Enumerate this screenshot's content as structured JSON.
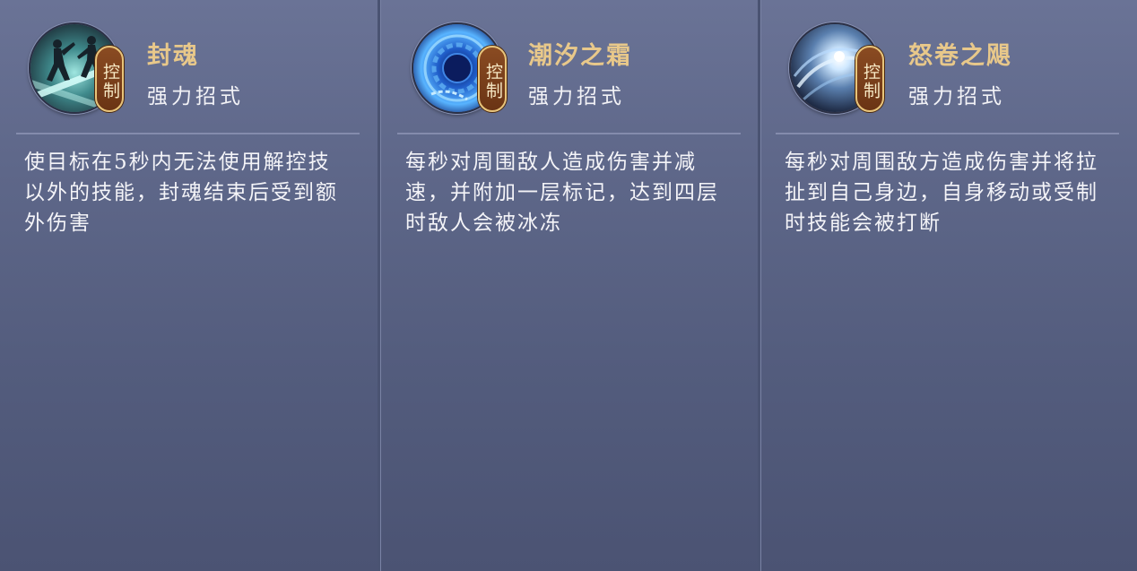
{
  "cards": [
    {
      "name": "封魂",
      "tag": "控制",
      "type": "强力招式",
      "description": "使目标在5秒内无法使用解控技以外的技能，封魂结束后受到额外伤害",
      "icon": "figures-slash-icon"
    },
    {
      "name": "潮汐之霜",
      "tag": "控制",
      "type": "强力招式",
      "description": "每秒对周围敌人造成伤害并减速，并附加一层标记，达到四层时敌人会被冰冻",
      "icon": "chain-vortex-icon"
    },
    {
      "name": "怒卷之飓",
      "tag": "控制",
      "type": "强力招式",
      "description": "每秒对周围敌方造成伤害并将拉扯到自己身边，自身移动或受制时技能会被打断",
      "icon": "whirlwind-icon"
    }
  ],
  "colors": {
    "name": "#e8c88a",
    "tag_bg": "#7a3f1a",
    "tag_border": "#e8c47a",
    "card_bg": "#5e6789"
  }
}
